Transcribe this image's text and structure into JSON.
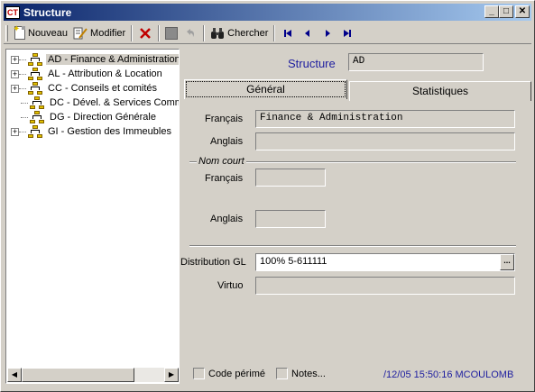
{
  "window": {
    "icon_text": "CT",
    "title": "Structure",
    "buttons": {
      "minimize": "_",
      "maximize": "□",
      "close": "✕"
    }
  },
  "toolbar": {
    "new_label": "Nouveau",
    "edit_label": "Modifier",
    "search_label": "Chercher",
    "nav": {
      "first": "⏮",
      "prev": "◀",
      "next": "▶",
      "last": "⏭"
    }
  },
  "tree": {
    "items": [
      {
        "label": "AD - Finance & Administration",
        "expandable": true,
        "selected": true
      },
      {
        "label": "AL - Attribution & Location",
        "expandable": true,
        "selected": false
      },
      {
        "label": "CC - Conseils et comités",
        "expandable": true,
        "selected": false
      },
      {
        "label": "DC - Dével. & Services Commu",
        "expandable": false,
        "selected": false
      },
      {
        "label": "DG - Direction Générale",
        "expandable": false,
        "selected": false
      },
      {
        "label": "GI - Gestion des Immeubles",
        "expandable": true,
        "selected": false
      }
    ],
    "scroll_left": "◀",
    "scroll_right": "▶"
  },
  "header": {
    "structure_label": "Structure",
    "structure_value": "AD"
  },
  "tabs": [
    {
      "label": "Général",
      "active": true
    },
    {
      "label": "Statistiques",
      "active": false
    }
  ],
  "form": {
    "francais_label": "Français",
    "francais_value": "Finance & Administration",
    "anglais_label": "Anglais",
    "anglais_value": "",
    "nom_court_title": "Nom court",
    "nc_francais_label": "Français",
    "nc_francais_value": "",
    "nc_anglais_label": "Anglais",
    "nc_anglais_value": "",
    "distribution_label": "Distribution GL",
    "distribution_value": "100% 5-611111",
    "distribution_button": "...",
    "virtuo_label": "Virtuo",
    "virtuo_value": ""
  },
  "footer": {
    "code_perime_label": "Code périmé",
    "notes_label": "Notes...",
    "status_text": "/12/05 15:50:16 MCOULOMB"
  },
  "colors": {
    "title_gradient_start": "#0a246a",
    "title_gradient_end": "#a6caf0",
    "accent_text": "#2020a0",
    "face": "#d4d0c8"
  }
}
